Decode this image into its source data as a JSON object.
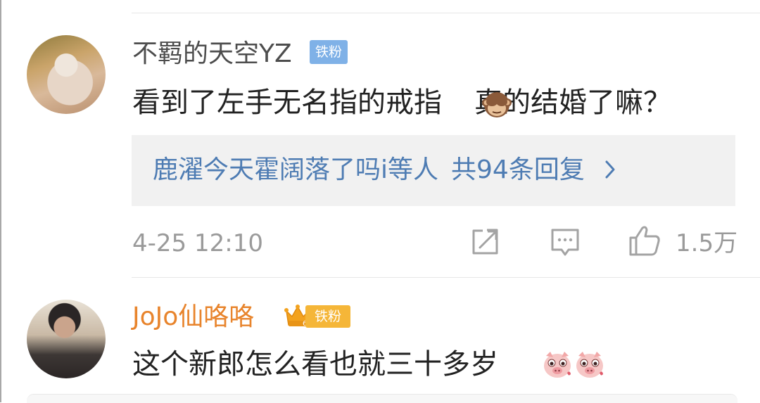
{
  "comments": [
    {
      "username": "不羁的天空YZ",
      "badge": "铁粉",
      "text": "看到了左手无名指的戒指",
      "text_after_emoji": "真的结婚了嘛？",
      "emoji": "monkey-see-no-evil-icon",
      "reply_summary": {
        "prefix": "鹿濯今天霍阔落了吗i等人",
        "count": "共94条回复"
      },
      "timestamp": "4-25 12:10",
      "likes": "1.5万"
    },
    {
      "username": "JoJo仙咯咯",
      "badge": "铁粉",
      "badge_level": "6",
      "text": "这个新郎怎么看也就三十多岁",
      "emoji": "pig-face-icon"
    }
  ],
  "colors": {
    "username_default": "#4d4d4d",
    "username_vip": "#e8842c",
    "link_blue": "#4e7cb3",
    "badge_blue": "#7fb1e7",
    "badge_gold": "#f5b638",
    "meta_gray": "#9a9a9a"
  }
}
